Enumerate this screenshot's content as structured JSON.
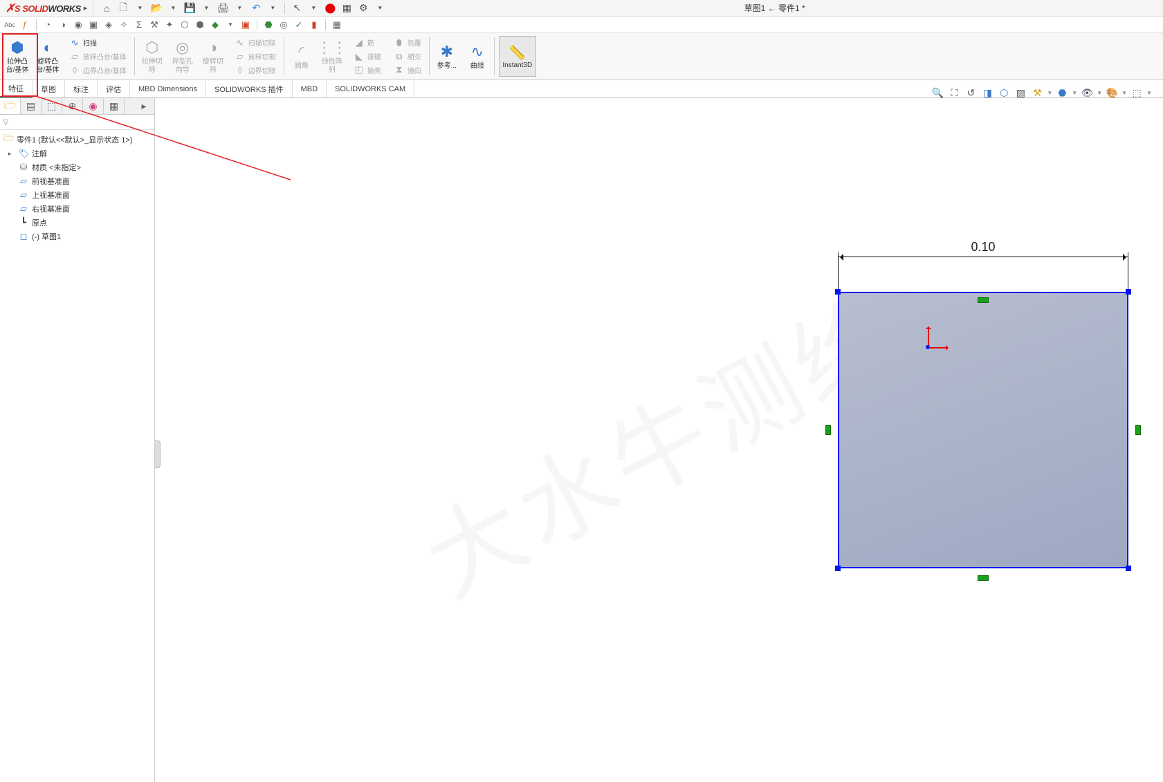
{
  "app": {
    "name_solid": "SOLID",
    "name_works": "WORKS"
  },
  "doc_title": "草图1 ← 零件1 *",
  "ribbon": {
    "extrude": "拉伸凸台/基体",
    "revolve": "旋转凸台/基体",
    "sweep": "扫描",
    "loft": "放样凸台/基体",
    "boundary": "边界凸台/基体",
    "extrude_cut": "拉伸切除",
    "hole_wizard": "异型孔向导",
    "revolve_cut": "旋转切除",
    "sweep_cut": "扫描切除",
    "loft_cut": "放样切割",
    "boundary_cut": "边界切除",
    "fillet": "圆角",
    "pattern": "线性阵列",
    "rib": "筋",
    "draft": "拔模",
    "shell": "抽壳",
    "wrap": "包覆",
    "intersect": "相交",
    "mirror": "镜向",
    "ref_geom": "参考...",
    "curves": "曲线",
    "instant3d": "Instant3D"
  },
  "tabs": {
    "features": "特征",
    "sketch": "草图",
    "annotate": "标注",
    "evaluate": "评估",
    "mbd_dim": "MBD Dimensions",
    "sw_addins": "SOLIDWORKS 插件",
    "mbd": "MBD",
    "sw_cam": "SOLIDWORKS CAM"
  },
  "tree": {
    "root": "零件1 (默认<<默认>_显示状态 1>)",
    "annotations": "注解",
    "material": "材质 <未指定>",
    "front": "前视基准面",
    "top": "上视基准面",
    "right": "右视基准面",
    "origin": "原点",
    "sketch1": "(-) 草图1"
  },
  "dimension": "0.10",
  "watermark": "大水牛测绘"
}
